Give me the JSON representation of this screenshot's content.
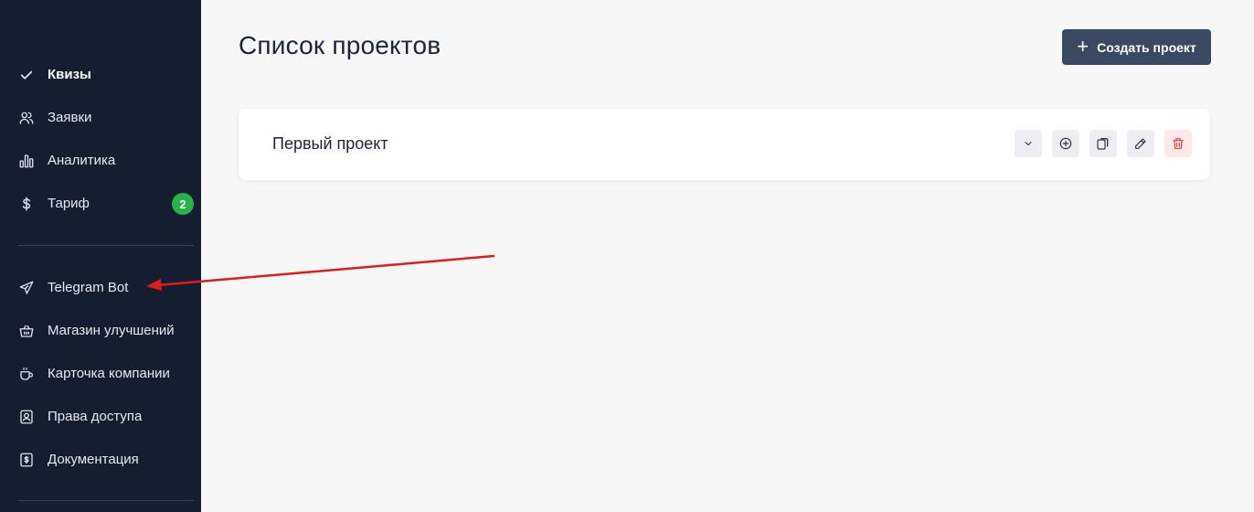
{
  "sidebar": {
    "main_items": [
      {
        "label": "Квизы",
        "icon": "check-icon",
        "active": true
      },
      {
        "label": "Заявки",
        "icon": "users-icon"
      },
      {
        "label": "Аналитика",
        "icon": "bar-chart-icon"
      },
      {
        "label": "Тариф",
        "icon": "dollar-icon",
        "badge": "2"
      }
    ],
    "extra_items": [
      {
        "label": "Telegram Bot",
        "icon": "send-icon"
      },
      {
        "label": "Магазин улучшений",
        "icon": "basket-icon"
      },
      {
        "label": "Карточка компании",
        "icon": "coffee-icon"
      },
      {
        "label": "Права доступа",
        "icon": "user-square-icon"
      },
      {
        "label": "Документация",
        "icon": "document-dollar-icon"
      }
    ]
  },
  "main": {
    "title": "Список проектов",
    "create_button": {
      "label": "Создать проект",
      "icon": "plus-icon"
    },
    "projects": [
      {
        "name": "Первый проект",
        "actions": [
          "chevron-down-icon",
          "plus-circle-icon",
          "copy-icon",
          "pencil-icon",
          "trash-icon"
        ]
      }
    ]
  },
  "colors": {
    "sidebar_bg": "#151d30",
    "main_bg": "#f7f7f7",
    "primary_button": "#3a4962",
    "badge": "#27b148",
    "danger": "#e04444",
    "annotation_arrow": "#e01b1b"
  }
}
